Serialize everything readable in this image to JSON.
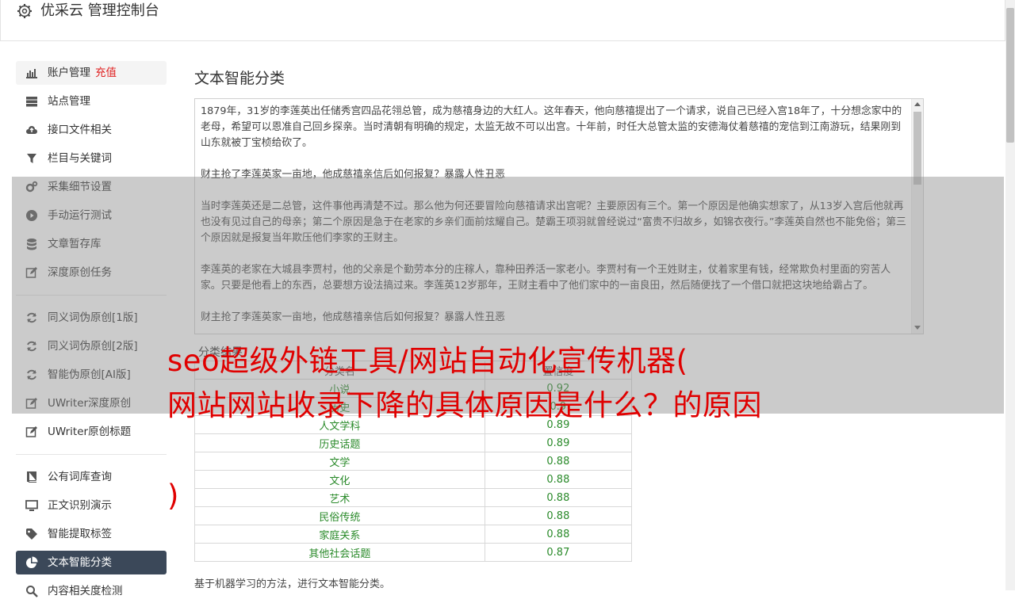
{
  "header": {
    "title": "优采云 管理控制台"
  },
  "sidebar": {
    "items": [
      {
        "label": "账户管理",
        "extra": "充值",
        "icon": "bar-chart-icon"
      },
      {
        "label": "站点管理",
        "icon": "server-icon"
      },
      {
        "label": "接口文件相关",
        "icon": "cloud-upload-icon"
      },
      {
        "label": "栏目与关键词",
        "icon": "filter-icon"
      },
      {
        "label": "采集细节设置",
        "icon": "gears-icon"
      },
      {
        "label": "手动运行测试",
        "icon": "play-circle-icon"
      },
      {
        "label": "文章暂存库",
        "icon": "database-icon"
      },
      {
        "label": "深度原创任务",
        "icon": "edit-icon"
      },
      {
        "label": "同义词伪原创[1版]",
        "icon": "refresh-icon"
      },
      {
        "label": "同义词伪原创[2版]",
        "icon": "refresh-icon"
      },
      {
        "label": "智能伪原创[AI版]",
        "icon": "refresh-icon"
      },
      {
        "label": "UWriter深度原创",
        "icon": "edit-icon"
      },
      {
        "label": "UWriter原创标题",
        "icon": "edit-icon"
      },
      {
        "label": "公有词库查询",
        "icon": "book-icon"
      },
      {
        "label": "正文识别演示",
        "icon": "monitor-icon"
      },
      {
        "label": "智能提取标签",
        "icon": "tag-icon"
      },
      {
        "label": "文本智能分类",
        "icon": "pie-chart-icon"
      },
      {
        "label": "内容相关度检测",
        "icon": "search-icon"
      }
    ]
  },
  "main": {
    "title": "文本智能分类",
    "text_paragraphs": [
      "1879年，31岁的李莲英出任储秀宫四品花翎总管，成为慈禧身边的大红人。这年春天，他向慈禧提出了一个请求，说自己已经入宫18年了，十分想念家中的老母，希望可以恩准自己回乡探亲。当时清朝有明确的规定，太监无故不可以出宫。十年前，时任大总管太监的安德海仗着慈禧的宠信到江南游玩，结果刚到山东就被丁宝桢给砍了。",
      "财主抢了李莲英家一亩地，他成慈禧亲信后如何报复？暴露人性丑恶",
      "当时李莲英还是二总管，这件事他再清楚不过。那么他为何还要冒险向慈禧请求出宫呢？主要原因有三个。第一个原因是他确实想家了，从13岁入宫后他就再也没有见过自己的母亲；第二个原因是急于在老家的乡亲们面前炫耀自己。楚霸王项羽就曾经说过“富贵不归故乡，如锦衣夜行。”李莲英自然也不能免俗；第三个原因就是报复当年欺压他们李家的王财主。",
      "李莲英的老家在大城县李贾村，他的父亲是个勤劳本分的庄稼人，靠种田养活一家老小。李贾村有一个王姓财主，仗着家里有钱，经常欺负村里面的穷苦人家。只要是他看上的东西，总要想方设法搞过来。李莲英12岁那年，王财主看中了他们家中的一亩良田，然后随便找了一个借口就把这块地给霸占了。",
      "财主抢了李莲英家一亩地，他成慈禧亲信后如何报复？暴露人性丑恶"
    ],
    "result_label": "分类结果",
    "table": {
      "headers": [
        "分类名",
        "置信度"
      ],
      "rows": [
        [
          "小说",
          "0.92"
        ],
        [
          "历史",
          "0.9"
        ],
        [
          "人文学科",
          "0.89"
        ],
        [
          "历史话题",
          "0.89"
        ],
        [
          "文学",
          "0.88"
        ],
        [
          "文化",
          "0.88"
        ],
        [
          "艺术",
          "0.88"
        ],
        [
          "民俗传统",
          "0.88"
        ],
        [
          "家庭关系",
          "0.88"
        ],
        [
          "其他社会话题",
          "0.87"
        ]
      ]
    },
    "footnote": "基于机器学习的方法，进行文本智能分类。"
  },
  "overlay": {
    "line1": "seo超级外链工具/网站自动化宣传机器(",
    "line2": "网站网站收录下降的具体原因是什么？的原因",
    "line3": ")"
  }
}
